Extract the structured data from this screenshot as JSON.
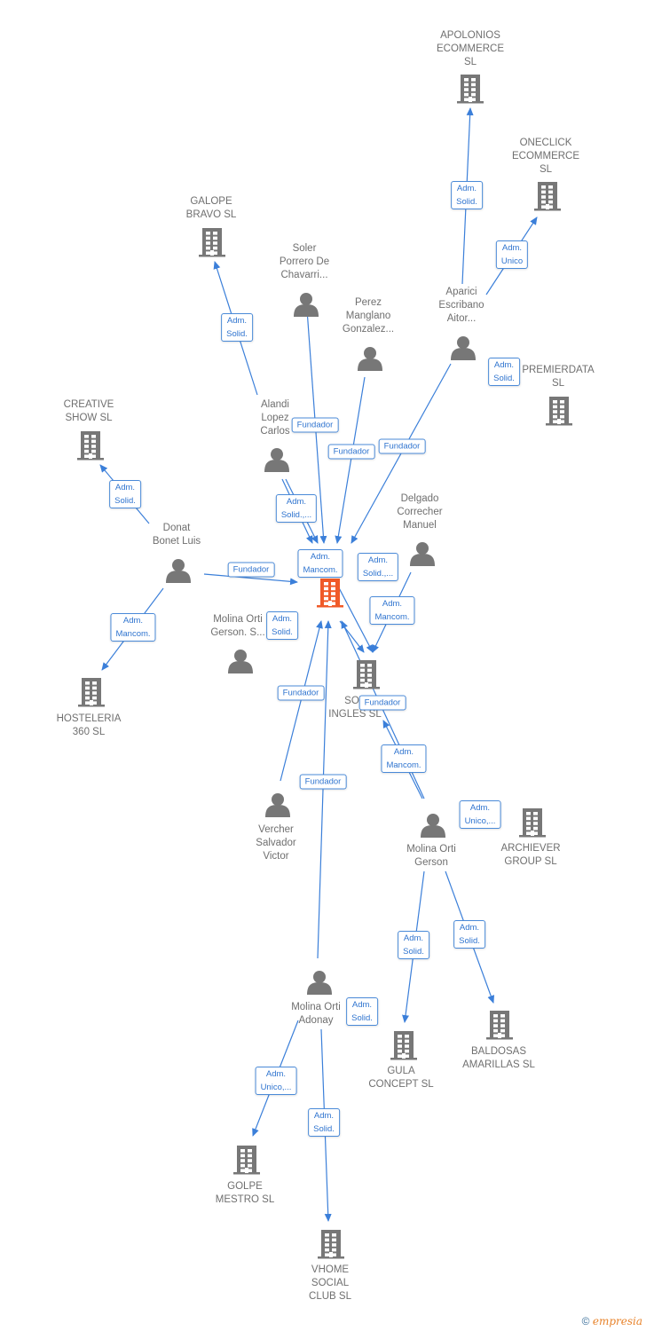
{
  "colors": {
    "edge": "#3b7fd9",
    "node_icon": "#777777",
    "center_icon": "#f05a28",
    "label_text": "#6f6f6f"
  },
  "nodes": [
    {
      "id": "apolonios",
      "type": "company",
      "label": [
        "APOLONIOS",
        "ECOMMERCE",
        "SL"
      ]
    },
    {
      "id": "oneclick",
      "type": "company",
      "label": [
        "ONECLICK",
        "ECOMMERCE",
        "SL"
      ]
    },
    {
      "id": "galope",
      "type": "company",
      "label": [
        "GALOPE",
        "BRAVO  SL"
      ]
    },
    {
      "id": "soler",
      "type": "person",
      "label": [
        "Soler",
        "Porrero De",
        "Chavarri..."
      ]
    },
    {
      "id": "perez",
      "type": "person",
      "label": [
        "Perez",
        "Manglano",
        "Gonzalez..."
      ]
    },
    {
      "id": "aparici",
      "type": "person",
      "label": [
        "Aparici",
        "Escribano",
        "Aitor..."
      ]
    },
    {
      "id": "premierdata",
      "type": "company",
      "label": [
        "PREMIERDATA",
        "SL"
      ]
    },
    {
      "id": "creative",
      "type": "company",
      "label": [
        "CREATIVE",
        "SHOW  SL"
      ]
    },
    {
      "id": "alandi",
      "type": "person",
      "label": [
        "Alandi",
        "Lopez",
        "Carlos"
      ]
    },
    {
      "id": "delgado",
      "type": "person",
      "label": [
        "Delgado",
        "Correcher",
        "Manuel"
      ]
    },
    {
      "id": "donat",
      "type": "person",
      "label": [
        "Donat",
        "Bonet Luis"
      ]
    },
    {
      "id": "center",
      "type": "company-main",
      "label": []
    },
    {
      "id": "molinags",
      "type": "person",
      "label": [
        "Molina Orti",
        "Gerson.  S..."
      ]
    },
    {
      "id": "soto",
      "type": "company",
      "label": [
        "SOT",
        "INGLES  SL"
      ]
    },
    {
      "id": "hosteleria",
      "type": "company",
      "label": [
        "HOSTELERIA",
        "360  SL"
      ]
    },
    {
      "id": "vercher",
      "type": "person",
      "label": [
        "Vercher",
        "Salvador",
        "Victor"
      ]
    },
    {
      "id": "molinag",
      "type": "person",
      "label": [
        "Molina Orti",
        "Gerson"
      ]
    },
    {
      "id": "archiever",
      "type": "company",
      "label": [
        "ARCHIEVER",
        "GROUP  SL"
      ]
    },
    {
      "id": "adonay",
      "type": "person",
      "label": [
        "Molina Orti",
        "Adonay"
      ]
    },
    {
      "id": "baldosas",
      "type": "company",
      "label": [
        "BALDOSAS",
        "AMARILLAS SL"
      ]
    },
    {
      "id": "gula",
      "type": "company",
      "label": [
        "GULA",
        "CONCEPT  SL"
      ]
    },
    {
      "id": "golpe",
      "type": "company",
      "label": [
        "GOLPE",
        "MESTRO  SL"
      ]
    },
    {
      "id": "vhome",
      "type": "company",
      "label": [
        "VHOME",
        "SOCIAL",
        "CLUB  SL"
      ]
    }
  ],
  "edges": [
    {
      "from": "aparici",
      "to": "apolonios",
      "label": [
        "Adm.",
        "Solid."
      ]
    },
    {
      "from": "aparici",
      "to": "oneclick",
      "label": [
        "Adm.",
        "Unico"
      ]
    },
    {
      "from": "alandi",
      "to": "galope",
      "label": [
        "Adm.",
        "Solid."
      ]
    },
    {
      "from": "aparici",
      "to": "premierdata",
      "label": [
        "Adm.",
        "Solid."
      ]
    },
    {
      "from": "donat",
      "to": "creative",
      "label": [
        "Adm.",
        "Solid."
      ]
    },
    {
      "from": "donat",
      "to": "hosteleria",
      "label": [
        "Adm.",
        "Mancom."
      ]
    },
    {
      "from": "donat",
      "to": "center",
      "label": [
        "Fundador"
      ]
    },
    {
      "from": "soler",
      "to": "center",
      "label": [
        "Fundador"
      ]
    },
    {
      "from": "perez",
      "to": "center",
      "label": [
        "Fundador"
      ]
    },
    {
      "from": "aparici",
      "to": "center",
      "label": [
        "Fundador"
      ]
    },
    {
      "from": "alandi",
      "to": "center",
      "label": [
        "Adm.",
        "Solid.,..."
      ]
    },
    {
      "from": "alandi",
      "to": "center",
      "label": [
        "Adm.",
        "Mancom."
      ]
    },
    {
      "from": "delgado",
      "to": "center",
      "label": [
        "Adm.",
        "Solid.,..."
      ]
    },
    {
      "from": "delgado",
      "to": "soto",
      "label": [
        "Adm.",
        "Mancom."
      ]
    },
    {
      "from": "molinags",
      "to": "center",
      "label": [
        "Adm.",
        "Solid."
      ]
    },
    {
      "from": "vercher",
      "to": "center",
      "label": [
        "Fundador"
      ]
    },
    {
      "from": "adonay",
      "to": "center",
      "label": [
        "Fundador"
      ]
    },
    {
      "from": "molinag",
      "to": "center",
      "label": [
        "Fundador"
      ]
    },
    {
      "from": "molinag",
      "to": "soto",
      "label": [
        "Adm.",
        "Mancom."
      ]
    },
    {
      "from": "molinag",
      "to": "archiever",
      "label": [
        "Adm.",
        "Unico,..."
      ]
    },
    {
      "from": "molinag",
      "to": "gula",
      "label": [
        "Adm.",
        "Solid."
      ]
    },
    {
      "from": "molinag",
      "to": "baldosas",
      "label": [
        "Adm.",
        "Solid."
      ]
    },
    {
      "from": "adonay",
      "to": "gula",
      "label": [
        "Adm.",
        "Solid."
      ]
    },
    {
      "from": "adonay",
      "to": "golpe",
      "label": [
        "Adm.",
        "Unico,..."
      ]
    },
    {
      "from": "adonay",
      "to": "vhome",
      "label": [
        "Adm.",
        "Solid."
      ]
    }
  ],
  "footer": {
    "copyright": "©",
    "brand": "empresia"
  }
}
